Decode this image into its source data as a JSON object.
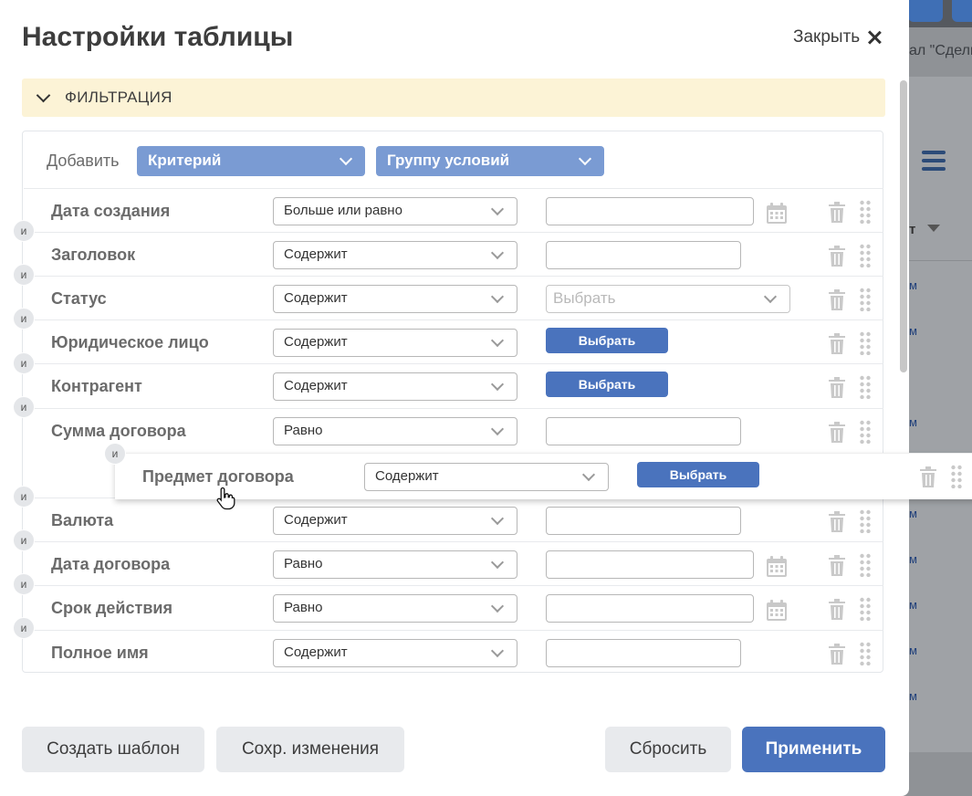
{
  "background": {
    "breadcrumb_fragment": "ал \"Сделк",
    "column_header_fragment": "т",
    "cell_fragment": "м"
  },
  "modal": {
    "title": "Настройки таблицы",
    "close_label": "Закрыть"
  },
  "filter": {
    "section_label": "ФИЛЬТРАЦИЯ",
    "add_label": "Добавить",
    "criterion_label": "Критерий",
    "group_label": "Группу условий",
    "connector": "и",
    "pick_label": "Выбрать",
    "rows": [
      {
        "label": "Дата создания",
        "operator": "Больше или равно",
        "value_type": "date"
      },
      {
        "label": "Заголовок",
        "operator": "Содержит",
        "value_type": "text"
      },
      {
        "label": "Статус",
        "operator": "Содержит",
        "value_type": "select",
        "value_placeholder": "Выбрать"
      },
      {
        "label": "Юридическое лицо",
        "operator": "Содержит",
        "value_type": "button"
      },
      {
        "label": "Контрагент",
        "operator": "Содержит",
        "value_type": "button"
      },
      {
        "label": "Сумма договора",
        "operator": "Равно",
        "value_type": "text"
      },
      {
        "label": "Валюта",
        "operator": "Содержит",
        "value_type": "text"
      },
      {
        "label": "Дата договора",
        "operator": "Равно",
        "value_type": "date"
      },
      {
        "label": "Срок действия",
        "operator": "Равно",
        "value_type": "date"
      },
      {
        "label": "Полное имя",
        "operator": "Содержит",
        "value_type": "text"
      }
    ],
    "dragging_row": {
      "label": "Предмет договора",
      "operator": "Содержит",
      "value_type": "button"
    }
  },
  "footer": {
    "create_template": "Создать шаблон",
    "save_changes": "Сохр. изменения",
    "reset": "Сбросить",
    "apply": "Применить"
  },
  "colors": {
    "primary": "#4a73bd",
    "light_blue": "#7a9bd3",
    "section_bg": "#fcf3d6"
  }
}
